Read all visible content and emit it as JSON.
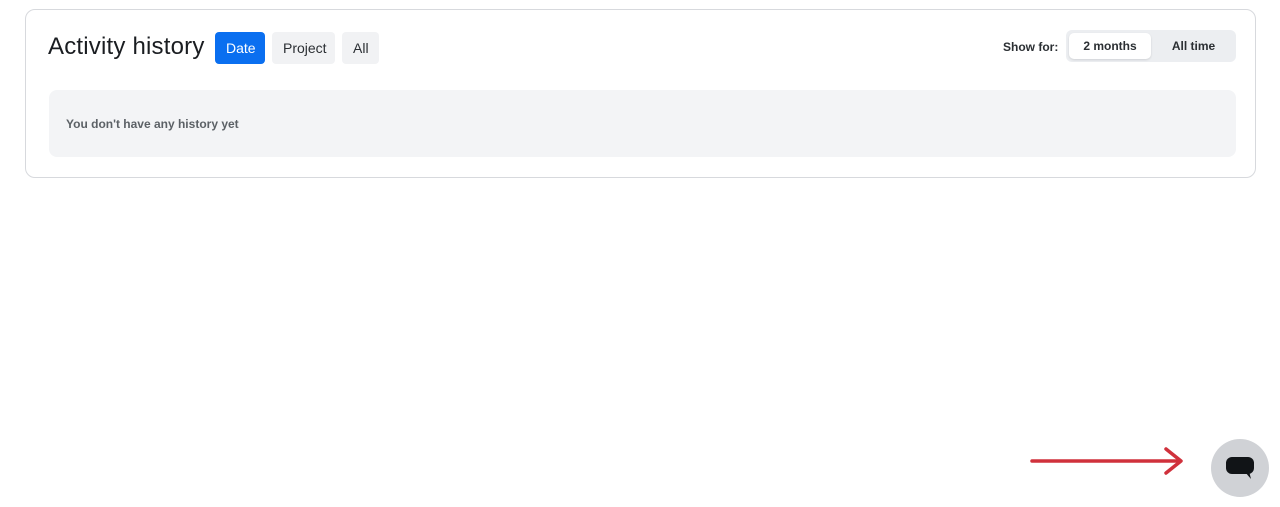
{
  "activity": {
    "title": "Activity history",
    "filters": [
      {
        "label": "Date",
        "active": true
      },
      {
        "label": "Project",
        "active": false
      },
      {
        "label": "All",
        "active": false
      }
    ],
    "show_for": {
      "label": "Show for:",
      "options": [
        {
          "label": "2 months",
          "selected": true
        },
        {
          "label": "All time",
          "selected": false
        }
      ]
    },
    "empty_message": "You don't have any history yet"
  },
  "icons": {
    "chat": "chat-icon",
    "arrow": "arrow-right-icon"
  },
  "colors": {
    "accent": "#0a6ff0",
    "arrow": "#d0313c",
    "fab": "#d0d2d6"
  }
}
